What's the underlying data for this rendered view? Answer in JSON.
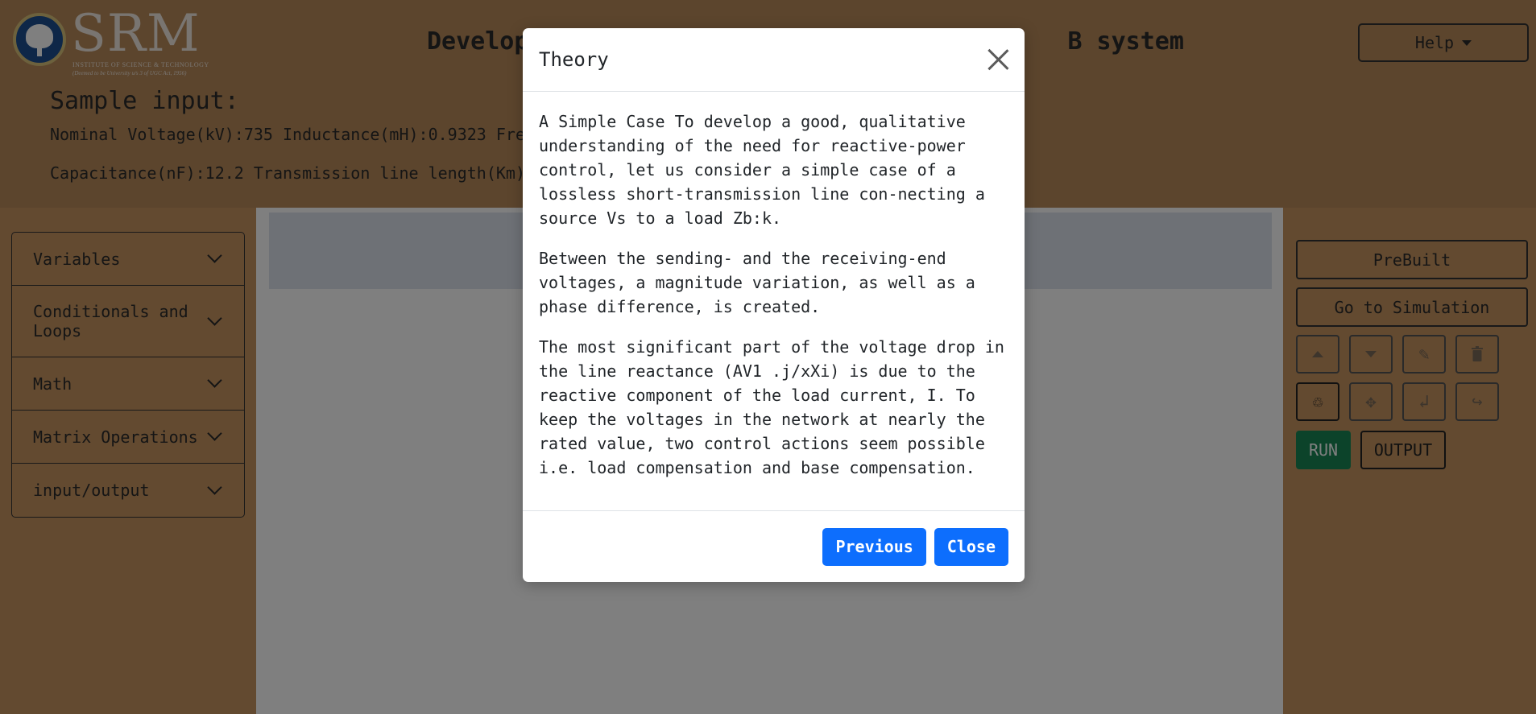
{
  "header": {
    "logo_text": "SRM",
    "logo_subtitle": "INSTITUTE OF SCIENCE & TECHNOLOGY",
    "logo_tagline": "(Deemed to be University u/s 3 of UGC Act, 1956)",
    "title_left": "Develop",
    "title_right": "B system",
    "help_label": "Help"
  },
  "sample": {
    "heading": "Sample input:",
    "line1": "Nominal Voltage(kV):735 Inductance(mH):0.9323 Fre",
    "line2": "Capacitance(nF):12.2 Transmission line length(Km)"
  },
  "sidebar": {
    "items": [
      {
        "label": "Variables"
      },
      {
        "label": "Conditionals and Loops"
      },
      {
        "label": "Math"
      },
      {
        "label": "Matrix Operations"
      },
      {
        "label": "input/output"
      }
    ]
  },
  "right_panel": {
    "prebuilt_label": "PreBuilt",
    "simulation_label": "Go to Simulation",
    "run_label": "RUN",
    "output_label": "OUTPUT"
  },
  "modal": {
    "title": "Theory",
    "paragraphs": [
      "A Simple Case To develop a good, qualitative understanding of the need for reactive-power control, let us consider a simple case of a lossless short-transmission line con-necting a source Vs to a load Zb:k.",
      "Between the sending- and the receiving-end voltages, a magnitude variation, as well as a phase difference, is created.",
      "The most significant part of the voltage drop in the line reactance (AV1 .j/xXi) is due to the reactive component of the load current, I. To keep the voltages in the network at nearly the rated value, two control actions seem possible i.e. load compensation and base compensation."
    ],
    "previous_label": "Previous",
    "close_label": "Close"
  }
}
